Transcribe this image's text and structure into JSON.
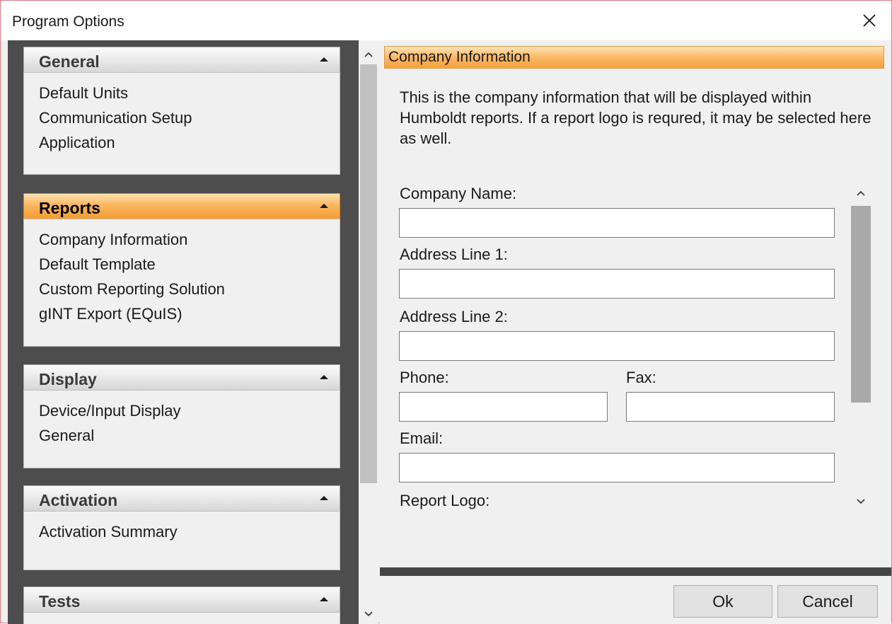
{
  "window": {
    "title": "Program Options"
  },
  "nav": {
    "groups": [
      {
        "label": "General",
        "items": [
          "Default Units",
          "Communication Setup",
          "Application"
        ]
      },
      {
        "label": "Reports",
        "items": [
          "Company Information",
          "Default Template",
          "Custom Reporting Solution",
          "gINT Export (EQuIS)"
        ]
      },
      {
        "label": "Display",
        "items": [
          "Device/Input Display",
          "General"
        ]
      },
      {
        "label": "Activation",
        "items": [
          "Activation Summary"
        ]
      },
      {
        "label": "Tests",
        "items": []
      }
    ]
  },
  "content": {
    "header": "Company Information",
    "description": "This is the company information that will be displayed within Humboldt reports.   If a report logo is requred, it may be selected here as well.",
    "form": {
      "company_name_label": "Company Name:",
      "company_name_value": "",
      "address1_label": "Address Line 1:",
      "address1_value": "",
      "address2_label": "Address Line 2:",
      "address2_value": "",
      "phone_label": "Phone:",
      "phone_value": "",
      "fax_label": "Fax:",
      "fax_value": "",
      "email_label": "Email:",
      "email_value": "",
      "report_logo_label": "Report Logo:"
    }
  },
  "buttons": {
    "ok": "Ok",
    "cancel": "Cancel"
  },
  "colors": {
    "accent_orange": "#fbb760",
    "nav_background": "#4d4d4d",
    "window_border": "#d97a84"
  }
}
